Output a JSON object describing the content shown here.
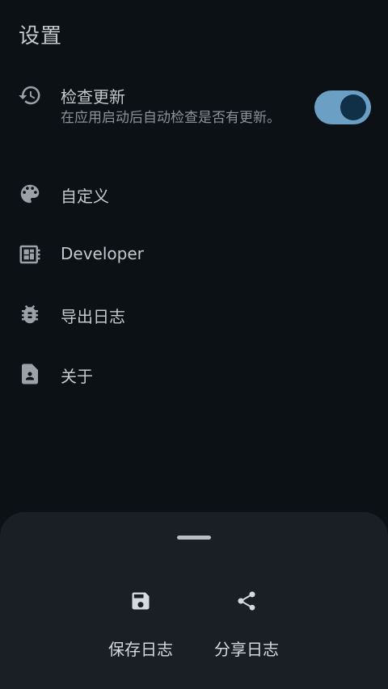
{
  "screen": {
    "title": "设置"
  },
  "settings": {
    "items": [
      {
        "label": "检查更新",
        "desc": "在应用启动后自动检查是否有更新。",
        "icon": "update-history-icon",
        "toggle_on": true
      },
      {
        "label": "自定义",
        "icon": "palette-icon"
      },
      {
        "label": "Developer",
        "icon": "developer-board-icon"
      },
      {
        "label": "导出日志",
        "icon": "bug-icon"
      },
      {
        "label": "关于",
        "icon": "contact-page-icon"
      }
    ]
  },
  "sheet": {
    "actions": [
      {
        "label": "保存日志",
        "icon": "save-icon"
      },
      {
        "label": "分享日志",
        "icon": "share-icon"
      }
    ]
  },
  "colors": {
    "background": "#0b1115",
    "sheet": "#1a1f26",
    "toggle_track": "#6b9fc4",
    "toggle_knob": "#0f3046",
    "text_primary": "#c4c9ce",
    "text_secondary": "#8b9298"
  }
}
